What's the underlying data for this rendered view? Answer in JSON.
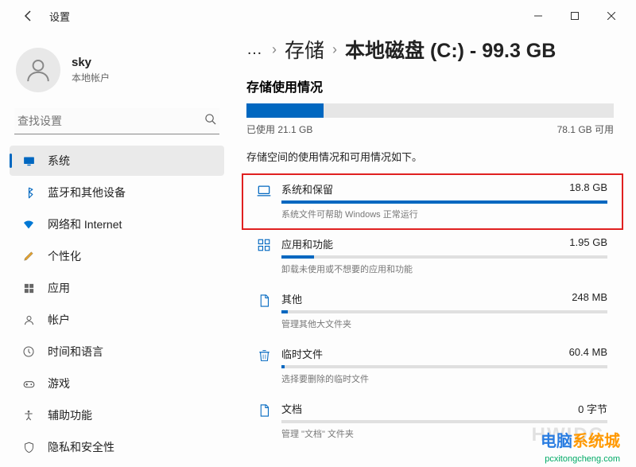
{
  "window": {
    "title": "设置"
  },
  "profile": {
    "name": "sky",
    "sub": "本地帐户"
  },
  "search": {
    "placeholder": "查找设置"
  },
  "nav": [
    {
      "icon": "display",
      "label": "系统",
      "active": true
    },
    {
      "icon": "bluetooth",
      "label": "蓝牙和其他设备"
    },
    {
      "icon": "wifi",
      "label": "网络和 Internet"
    },
    {
      "icon": "brush",
      "label": "个性化"
    },
    {
      "icon": "apps",
      "label": "应用"
    },
    {
      "icon": "person",
      "label": "帐户"
    },
    {
      "icon": "clock",
      "label": "时间和语言"
    },
    {
      "icon": "game",
      "label": "游戏"
    },
    {
      "icon": "accessibility",
      "label": "辅助功能"
    },
    {
      "icon": "shield",
      "label": "隐私和安全性"
    }
  ],
  "breadcrumb": {
    "dots": "…",
    "l1": "存储",
    "l2": "本地磁盘 (C:) - 99.3 GB"
  },
  "storage": {
    "section_title": "存储使用情况",
    "used_label": "已使用 21.1 GB",
    "free_label": "78.1 GB 可用",
    "used_percent": 21,
    "desc": "存储空间的使用情况和可用情况如下。"
  },
  "categories": [
    {
      "icon": "laptop",
      "name": "系统和保留",
      "size": "18.8 GB",
      "sub": "系统文件可帮助 Windows 正常运行",
      "fill": 100,
      "highlighted": true
    },
    {
      "icon": "grid",
      "name": "应用和功能",
      "size": "1.95 GB",
      "sub": "卸载未使用或不想要的应用和功能",
      "fill": 10
    },
    {
      "icon": "doc",
      "name": "其他",
      "size": "248 MB",
      "sub": "管理其他大文件夹",
      "fill": 2
    },
    {
      "icon": "trash",
      "name": "临时文件",
      "size": "60.4 MB",
      "sub": "选择要删除的临时文件",
      "fill": 1
    },
    {
      "icon": "doc",
      "name": "文档",
      "size": "0 字节",
      "sub": "管理 \"文档\" 文件夹",
      "fill": 0
    }
  ],
  "watermark": {
    "logo": "HWIDC",
    "brand1": "电脑",
    "brand2": "系统城",
    "url": "pcxitongcheng.com"
  }
}
